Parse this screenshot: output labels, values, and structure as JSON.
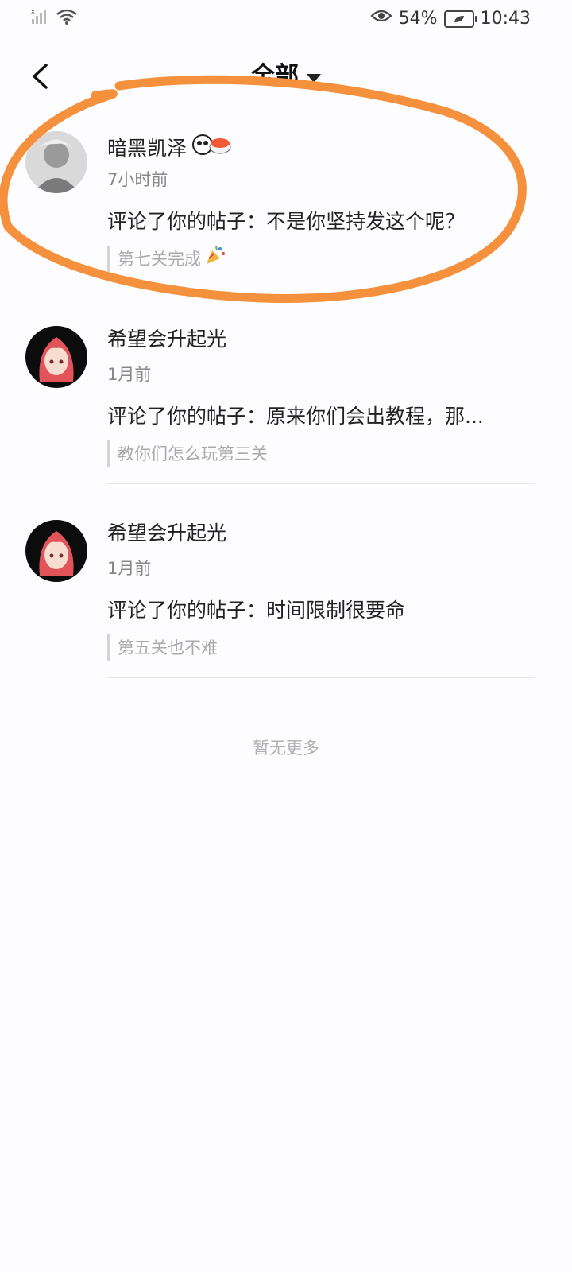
{
  "status_bar": {
    "battery_percent": "54%",
    "time": "10:43"
  },
  "header": {
    "title": "全部"
  },
  "notifications": [
    {
      "username": "暗黑凯泽",
      "time": "7小时前",
      "comment": "评论了你的帖子：不是你坚持发这个呢？",
      "post_title": "第七关完成"
    },
    {
      "username": "希望会升起光",
      "time": "1月前",
      "comment": "评论了你的帖子：原来你们会出教程，那...",
      "post_title": "教你们怎么玩第三关"
    },
    {
      "username": "希望会升起光",
      "time": "1月前",
      "comment": "评论了你的帖子：时间限制很要命",
      "post_title": "第五关也不难"
    }
  ],
  "footer": {
    "no_more_text": "暂无更多"
  },
  "colors": {
    "annotation_stroke": "#f5913c",
    "background": "#fdfcfe"
  }
}
